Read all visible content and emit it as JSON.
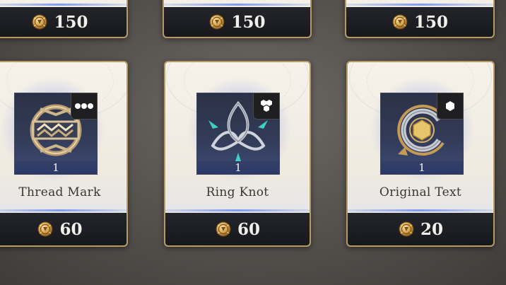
{
  "colors": {
    "card_border": "#b59a63",
    "price_bar": "#1a1b1f",
    "accent_blue": "#7f9cf0",
    "coin_gold": "#d3a24d"
  },
  "top_row": [
    {
      "price": "150",
      "currency_icon": "coin-icon"
    },
    {
      "price": "150",
      "currency_icon": "coin-icon"
    },
    {
      "price": "150",
      "currency_icon": "coin-icon"
    }
  ],
  "items": [
    {
      "name": "Thread Mark",
      "quantity": "1",
      "rarity_icon": "three-circles-icon",
      "price": "60",
      "currency_icon": "coin-icon"
    },
    {
      "name": "Ring Knot",
      "quantity": "1",
      "rarity_icon": "honeycomb-icon",
      "price": "60",
      "currency_icon": "coin-icon"
    },
    {
      "name": "Original Text",
      "quantity": "1",
      "rarity_icon": "hexagon-icon",
      "price": "20",
      "currency_icon": "coin-icon"
    }
  ]
}
